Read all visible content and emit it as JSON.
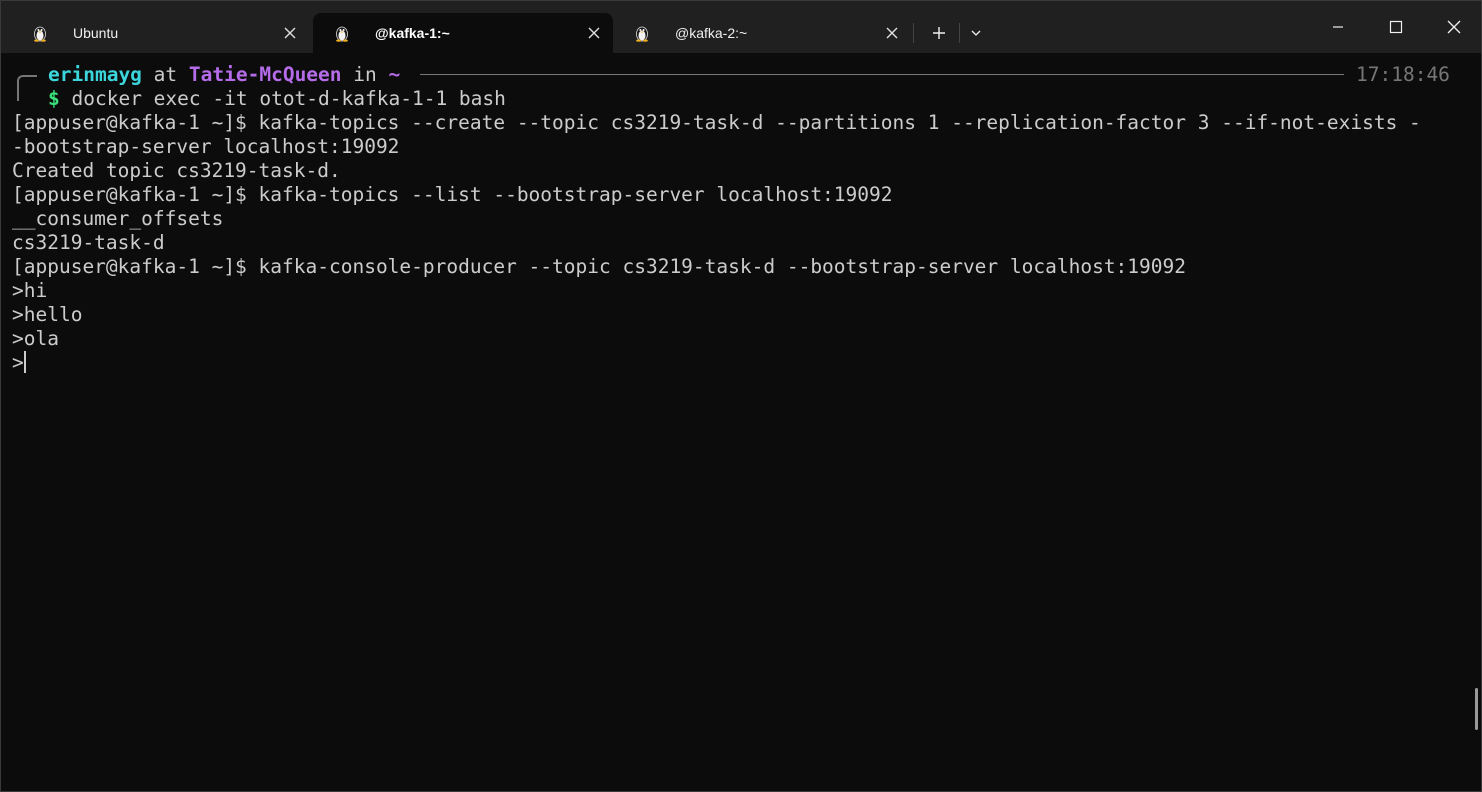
{
  "tabs": [
    {
      "title": "Ubuntu",
      "icon": "linux-penguin-icon",
      "active": false
    },
    {
      "title": "@kafka-1:~",
      "icon": "linux-penguin-icon",
      "active": true
    },
    {
      "title": "@kafka-2:~",
      "icon": "linux-penguin-icon",
      "active": false
    }
  ],
  "prompt": {
    "user": "erinmayg",
    "at": "at",
    "host": "Tatie-McQueen",
    "in": "in",
    "dir": "~",
    "time": "17:18:46",
    "dollar": "$",
    "command": "docker exec -it otot-d-kafka-1-1 bash"
  },
  "output_lines": [
    "[appuser@kafka-1 ~]$ kafka-topics --create --topic cs3219-task-d --partitions 1 --replication-factor 3 --if-not-exists -",
    "-bootstrap-server localhost:19092",
    "Created topic cs3219-task-d.",
    "[appuser@kafka-1 ~]$ kafka-topics --list --bootstrap-server localhost:19092",
    "__consumer_offsets",
    "cs3219-task-d",
    "[appuser@kafka-1 ~]$ kafka-console-producer --topic cs3219-task-d --bootstrap-server localhost:19092",
    ">hi",
    ">hello",
    ">ola",
    ">"
  ],
  "colors": {
    "background": "#0c0c0c",
    "titlebar": "#202020",
    "user": "#3ad6dc",
    "host": "#b46ce8",
    "dollar": "#3ae07a",
    "text": "#cccccc",
    "muted": "#767676"
  }
}
